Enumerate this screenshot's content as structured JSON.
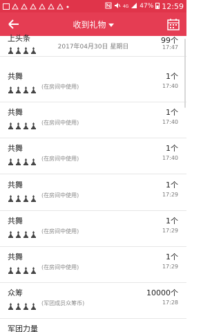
{
  "status": {
    "battery": "47%",
    "time": "12:59",
    "network": "4G"
  },
  "header": {
    "title": "收到礼物",
    "accent": "#e53d53"
  },
  "date_banner": "2017年04月30日 星期日",
  "items": [
    {
      "name": "上头条",
      "count": "99个",
      "note": "(在房间中使用)",
      "time": "17:47"
    },
    {
      "name": "共舞",
      "count": "1个",
      "note": "(在房间中使用)",
      "time": "17:40"
    },
    {
      "name": "共舞",
      "count": "1个",
      "note": "(在房间中使用)",
      "time": "17:40"
    },
    {
      "name": "共舞",
      "count": "1个",
      "note": "(在房间中使用)",
      "time": "17:40"
    },
    {
      "name": "共舞",
      "count": "1个",
      "note": "(在房间中使用)",
      "time": "17:29"
    },
    {
      "name": "共舞",
      "count": "1个",
      "note": "(在房间中使用)",
      "time": "17:29"
    },
    {
      "name": "共舞",
      "count": "1个",
      "note": "(在房间中使用)",
      "time": "17:29"
    },
    {
      "name": "众筹",
      "count": "10000个",
      "note": "(军团成员众筹币)",
      "time": "17:28"
    },
    {
      "name": "军团力量",
      "count": "",
      "note": "",
      "time": ""
    }
  ]
}
